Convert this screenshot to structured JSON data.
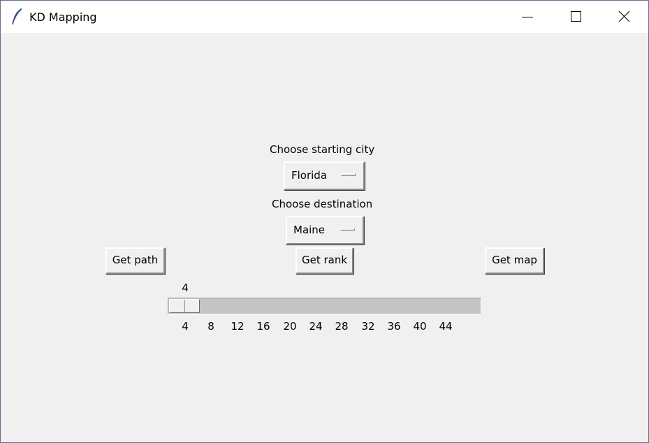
{
  "window": {
    "title": "KD Mapping",
    "icon": "feather-icon"
  },
  "form": {
    "start_label": "Choose starting city",
    "start_value": "Florida",
    "dest_label": "Choose destination",
    "dest_value": "Maine"
  },
  "buttons": {
    "get_path": "Get path",
    "get_rank": "Get rank",
    "get_map": "Get map"
  },
  "scale": {
    "value": "4",
    "ticks": [
      "4",
      "8",
      "12",
      "16",
      "20",
      "24",
      "28",
      "32",
      "36",
      "40",
      "44"
    ]
  }
}
